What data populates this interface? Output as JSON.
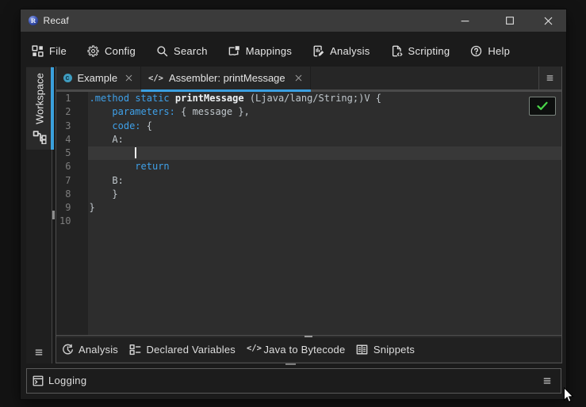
{
  "colors": {
    "accent_blue": "#3aa0dc",
    "keyword_blue": "#3fa0e8",
    "check_green": "#49d649",
    "titlebar_bg": "#3b3b3b",
    "editor_bg": "#2d2d2d"
  },
  "titlebar": {
    "title": "Recaf",
    "logo_letter": "R",
    "controls": [
      {
        "name": "minimize",
        "icon": "minimize-icon"
      },
      {
        "name": "maximize",
        "icon": "maximize-icon"
      },
      {
        "name": "close",
        "icon": "close-icon"
      }
    ]
  },
  "menubar": {
    "items": [
      {
        "id": "file",
        "label": "File",
        "icon": "workspace-grid-icon"
      },
      {
        "id": "config",
        "label": "Config",
        "icon": "gear-icon"
      },
      {
        "id": "search",
        "label": "Search",
        "icon": "search-icon"
      },
      {
        "id": "mappings",
        "label": "Mappings",
        "icon": "mapping-icon"
      },
      {
        "id": "analysis",
        "label": "Analysis",
        "icon": "report-edit-icon"
      },
      {
        "id": "scripting",
        "label": "Scripting",
        "icon": "script-file-icon"
      },
      {
        "id": "help",
        "label": "Help",
        "icon": "help-icon"
      }
    ]
  },
  "sidebar": {
    "tabs": [
      {
        "id": "workspace",
        "label": "Workspace",
        "icon": "workspace-tree-icon",
        "selected": true
      }
    ],
    "menu_icon": "menu-icon"
  },
  "editor_tabs": {
    "tabs": [
      {
        "id": "example",
        "label": "Example",
        "icon": "class-icon",
        "icon_letter": "c",
        "close_icon": "close-icon",
        "selected": false
      },
      {
        "id": "assembler",
        "label": "Assembler: printMessage",
        "icon": "code-icon",
        "icon_text": "</>",
        "close_icon": "close-icon",
        "selected": true
      }
    ],
    "menu_icon": "menu-icon"
  },
  "editor": {
    "line_numbers": [
      "1",
      "2",
      "3",
      "4",
      "5",
      "6",
      "7",
      "8",
      "9",
      "10"
    ],
    "current_line": 5,
    "caret": {
      "line": 5,
      "column": 8
    },
    "lines": [
      {
        "tokens": [
          {
            "text": ".method",
            "type": "keyword"
          },
          {
            "text": " ",
            "type": "plain"
          },
          {
            "text": "static",
            "type": "keyword"
          },
          {
            "text": " ",
            "type": "plain"
          },
          {
            "text": "printMessage",
            "type": "identifier"
          },
          {
            "text": " (Ljava/lang/String;)V {",
            "type": "plain"
          }
        ]
      },
      {
        "tokens": [
          {
            "text": "    ",
            "type": "plain"
          },
          {
            "text": "parameters:",
            "type": "keyword"
          },
          {
            "text": " { message },",
            "type": "plain"
          }
        ]
      },
      {
        "tokens": [
          {
            "text": "    ",
            "type": "plain"
          },
          {
            "text": "code:",
            "type": "keyword"
          },
          {
            "text": " {",
            "type": "plain"
          }
        ]
      },
      {
        "tokens": [
          {
            "text": "    A:",
            "type": "plain"
          }
        ]
      },
      {
        "tokens": []
      },
      {
        "tokens": [
          {
            "text": "        ",
            "type": "plain"
          },
          {
            "text": "return",
            "type": "keyword"
          }
        ]
      },
      {
        "tokens": [
          {
            "text": "    B:",
            "type": "plain"
          }
        ]
      },
      {
        "tokens": [
          {
            "text": "    }",
            "type": "plain"
          }
        ]
      },
      {
        "tokens": [
          {
            "text": "}",
            "type": "plain"
          }
        ]
      },
      {
        "tokens": []
      }
    ],
    "status_button": {
      "icon": "check-icon",
      "state": "valid"
    }
  },
  "assembler_toolbar": {
    "items": [
      {
        "id": "analysis",
        "label": "Analysis",
        "icon": "history-icon"
      },
      {
        "id": "declared-variables",
        "label": "Declared Variables",
        "icon": "variables-list-icon"
      },
      {
        "id": "java-to-bytecode",
        "label": "Java to Bytecode",
        "icon": "code-icon"
      },
      {
        "id": "snippets",
        "label": "Snippets",
        "icon": "snippets-book-icon"
      }
    ]
  },
  "logging_panel": {
    "label": "Logging",
    "icon": "terminal-icon",
    "menu_icon": "menu-icon"
  }
}
